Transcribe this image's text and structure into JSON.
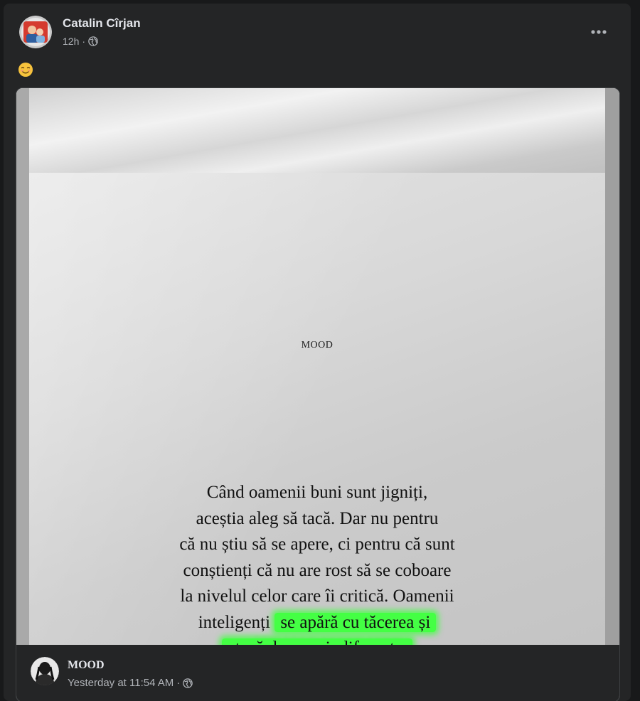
{
  "post": {
    "author": "Catalin Cîrjan",
    "time": "12h",
    "separator": "·",
    "privacy_icon": "globe-icon",
    "more_icon": "more-options-icon",
    "emoji": "smiling-face-emoji"
  },
  "shared_image": {
    "page_header": "MOOD",
    "quote_lines": [
      "Când oamenii buni sunt jigniți,",
      "aceștia aleg să tacă. Dar nu pentru",
      "că nu știu să se apere, ci pentru că sunt",
      "conștienți că nu are rost să se coboare",
      "la nivelul celor care îi critică. Oamenii"
    ],
    "quote_line6_plain": "inteligenți ",
    "quote_line6_highlight": "se apără cu tăcerea și",
    "quote_line7_highlight": "atacă doar cu indiferența.",
    "highlight_color": "#44ff44"
  },
  "source": {
    "name": "MOOD",
    "time": "Yesterday at 11:54 AM",
    "separator": "·",
    "privacy_icon": "globe-icon"
  },
  "colors": {
    "background": "#18191a",
    "card": "#242526",
    "text_primary": "#e4e6eb",
    "text_secondary": "#b0b3b8"
  }
}
